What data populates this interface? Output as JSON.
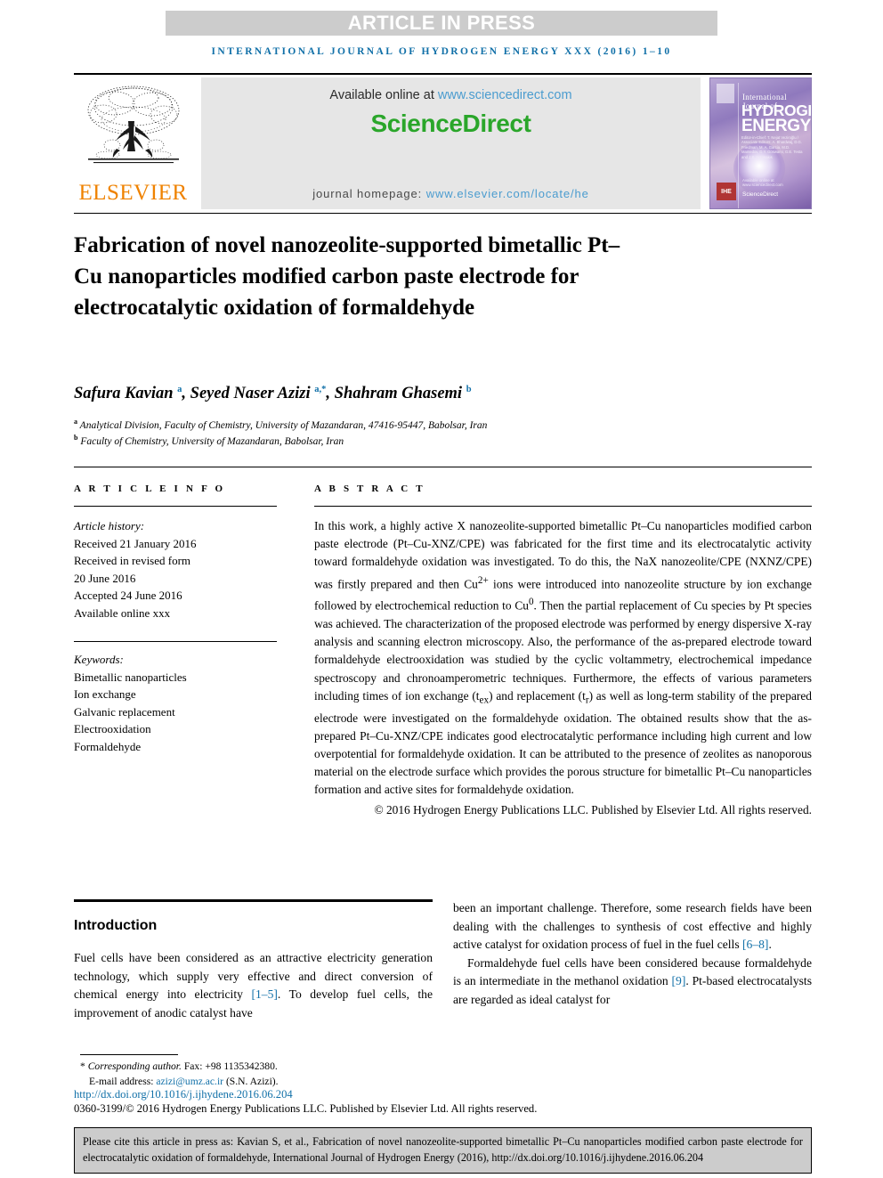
{
  "banner": {
    "article_in_press": "ARTICLE IN PRESS",
    "running_head": "INTERNATIONAL JOURNAL OF HYDROGEN ENERGY XXX (2016) 1–10"
  },
  "masthead": {
    "publisher_name": "ELSEVIER",
    "available_prefix": "Available online at ",
    "available_url": "www.sciencedirect.com",
    "sciencedirect_logo": "ScienceDirect",
    "homepage_prefix": "journal homepage: ",
    "homepage_url": "www.elsevier.com/locate/he",
    "cover": {
      "line_small": "International Journal of",
      "line_hydrogen": "HYDROGEN",
      "line_energy": "ENERGY",
      "editors": "Editor-in-Chief: T. Nejat Veziroğlu / Associate Editors: A. Bhardwaj, D.G. Friedman, M. A. Garcia, M.D. Mamedov, D.Y. Goswami, G.E. Testa and J.S. Antonakis",
      "badge": "IHE",
      "sciencedirect_label": "ScienceDirect",
      "sciencedirect_sub": "Available online at www.sciencedirect.com"
    }
  },
  "article": {
    "title": "Fabrication of novel nanozeolite-supported bimetallic Pt–Cu nanoparticles modified carbon paste electrode for electrocatalytic oxidation of formaldehyde",
    "authors_html": "Safura Kavian <sup>a</sup>, Seyed Naser Azizi <sup>a,*</sup>, Shahram Ghasemi <sup>b</sup>",
    "affiliation_a": "Analytical Division, Faculty of Chemistry, University of Mazandaran, 47416-95447, Babolsar, Iran",
    "affiliation_b": "Faculty of Chemistry, University of Mazandaran, Babolsar, Iran",
    "affiliation_a_marker": "a",
    "affiliation_b_marker": "b"
  },
  "article_info": {
    "section_label": "A R T I C L E   I N F O",
    "history_heading": "Article history:",
    "history": [
      "Received 21 January 2016",
      "Received in revised form",
      "20 June 2016",
      "Accepted 24 June 2016",
      "Available online xxx"
    ],
    "keywords_heading": "Keywords:",
    "keywords": [
      "Bimetallic nanoparticles",
      "Ion exchange",
      "Galvanic replacement",
      "Electrooxidation",
      "Formaldehyde"
    ]
  },
  "abstract": {
    "section_label": "A B S T R A C T",
    "body_html": "In this work, a highly active X nanozeolite-supported bimetallic Pt–Cu nanoparticles modified carbon paste electrode (Pt–Cu-XNZ/CPE) was fabricated for the first time and its electrocatalytic activity toward formaldehyde oxidation was investigated. To do this, the NaX nanozeolite/CPE (NXNZ/CPE) was firstly prepared and then Cu<sup>2+</sup> ions were introduced into nanozeolite structure by ion exchange followed by electrochemical reduction to Cu<sup>0</sup>. Then the partial replacement of Cu species by Pt species was achieved. The characterization of the proposed electrode was performed by energy dispersive X-ray analysis and scanning electron microscopy. Also, the performance of the as-prepared electrode toward formaldehyde electrooxidation was studied by the cyclic voltammetry, electrochemical impedance spectroscopy and chronoamperometric techniques. Furthermore, the effects of various parameters including times of ion exchange (t<sub>ex</sub>) and replacement (t<sub>r</sub>) as well as long-term stability of the prepared electrode were investigated on the formaldehyde oxidation. The obtained results show that the as-prepared Pt–Cu-XNZ/CPE indicates good electrocatalytic performance including high current and low overpotential for formaldehyde oxidation. It can be attributed to the presence of zeolites as nanoporous material on the electrode surface which provides the porous structure for bimetallic Pt–Cu nanoparticles formation and active sites for formaldehyde oxidation.",
    "copyright": "© 2016 Hydrogen Energy Publications LLC. Published by Elsevier Ltd. All rights reserved."
  },
  "introduction": {
    "heading": "Introduction",
    "left_paragraph_html": "Fuel cells have been considered as an attractive electricity generation technology, which supply very effective and direct conversion of chemical energy into electricity <span class=\"cite\">[1–5]</span>. To develop fuel cells, the improvement of anodic catalyst have",
    "right_paragraph_1_html": "been an important challenge. Therefore, some research fields have been dealing with the challenges to synthesis of cost effective and highly active catalyst for oxidation process of fuel in the fuel cells <span class=\"cite\">[6–8]</span>.",
    "right_paragraph_2_html": "Formaldehyde fuel cells have been considered because formaldehyde is an intermediate in the methanol oxidation <span class=\"cite\">[9]</span>. Pt-based electrocatalysts are regarded as ideal catalyst for"
  },
  "footer": {
    "corresponding_html": "* <span class=\"it\">Corresponding author.</span> Fax: +98 1135342380.",
    "email_prefix": "E-mail address: ",
    "email": "azizi@umz.ac.ir",
    "email_suffix": " (S.N. Azizi).",
    "doi": "http://dx.doi.org/10.1016/j.ijhydene.2016.06.204",
    "issn_line": "0360-3199/© 2016 Hydrogen Energy Publications LLC. Published by Elsevier Ltd. All rights reserved.",
    "cite_box": "Please cite this article in press as: Kavian S, et al., Fabrication of novel nanozeolite-supported bimetallic Pt–Cu nanoparticles modified carbon paste electrode for electrocatalytic oxidation of formaldehyde, International Journal of Hydrogen Energy (2016), http://dx.doi.org/10.1016/j.ijhydene.2016.06.204"
  },
  "colors": {
    "link_blue": "#1170a8",
    "sciencedirect_green": "#2aa62a",
    "elsevier_orange": "#ef8200",
    "banner_gray": "#cccccc",
    "panel_gray": "#e6e6e6"
  }
}
